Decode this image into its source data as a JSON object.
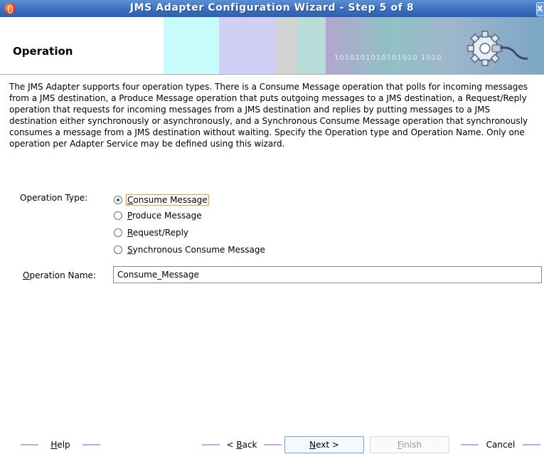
{
  "window": {
    "title": "JMS Adapter Configuration Wizard - Step 5 of 8",
    "close_glyph": "X"
  },
  "header": {
    "title": "Operation",
    "banner_text": "1010101010101010 1010",
    "icon": "gear-plug-icon"
  },
  "description": "The JMS Adapter supports four operation types.  There is a Consume Message operation that polls for incoming messages from a JMS destination, a Produce Message operation that puts outgoing messages to a JMS destination, a Request/Reply operation that requests for incoming messages from a JMS destination and replies by putting messages to a JMS destination either synchronously or asynchronously, and a Synchronous Consume Message operation that synchronously consumes a message from a JMS destination without waiting.  Specify the Operation type and Operation Name.  Only one operation per Adapter Service may be defined using this wizard.",
  "operation_type": {
    "label": "Operation Type:",
    "options": [
      {
        "label": "Consume Message",
        "mnemonic": "C",
        "rest": "onsume Message",
        "selected": true
      },
      {
        "label": "Produce Message",
        "mnemonic": "P",
        "rest": "roduce Message",
        "selected": false
      },
      {
        "label": "Request/Reply",
        "mnemonic": "R",
        "rest": "equest/Reply",
        "selected": false
      },
      {
        "label": "Synchronous Consume Message",
        "mnemonic": "S",
        "rest": "ynchronous Consume Message",
        "selected": false
      }
    ]
  },
  "operation_name": {
    "label": "Operation Name:",
    "label_mnemonic": "O",
    "label_rest": "peration Name:",
    "value": "Consume_Message"
  },
  "buttons": {
    "help": {
      "label": "Help",
      "mnemonic": "H",
      "rest": "elp"
    },
    "back": {
      "label": "< Back",
      "prefix": "< ",
      "mnemonic": "B",
      "rest": "ack"
    },
    "next": {
      "label": "Next >",
      "mnemonic": "N",
      "rest": "ext >"
    },
    "finish": {
      "label": "Finish",
      "mnemonic": "F",
      "rest": "inish",
      "enabled": false
    },
    "cancel": {
      "label": "Cancel"
    }
  },
  "colors": {
    "titlebar": "#3b6fbf",
    "accent_focus": "#f0a030",
    "radio_dot": "#2a5aa8"
  }
}
